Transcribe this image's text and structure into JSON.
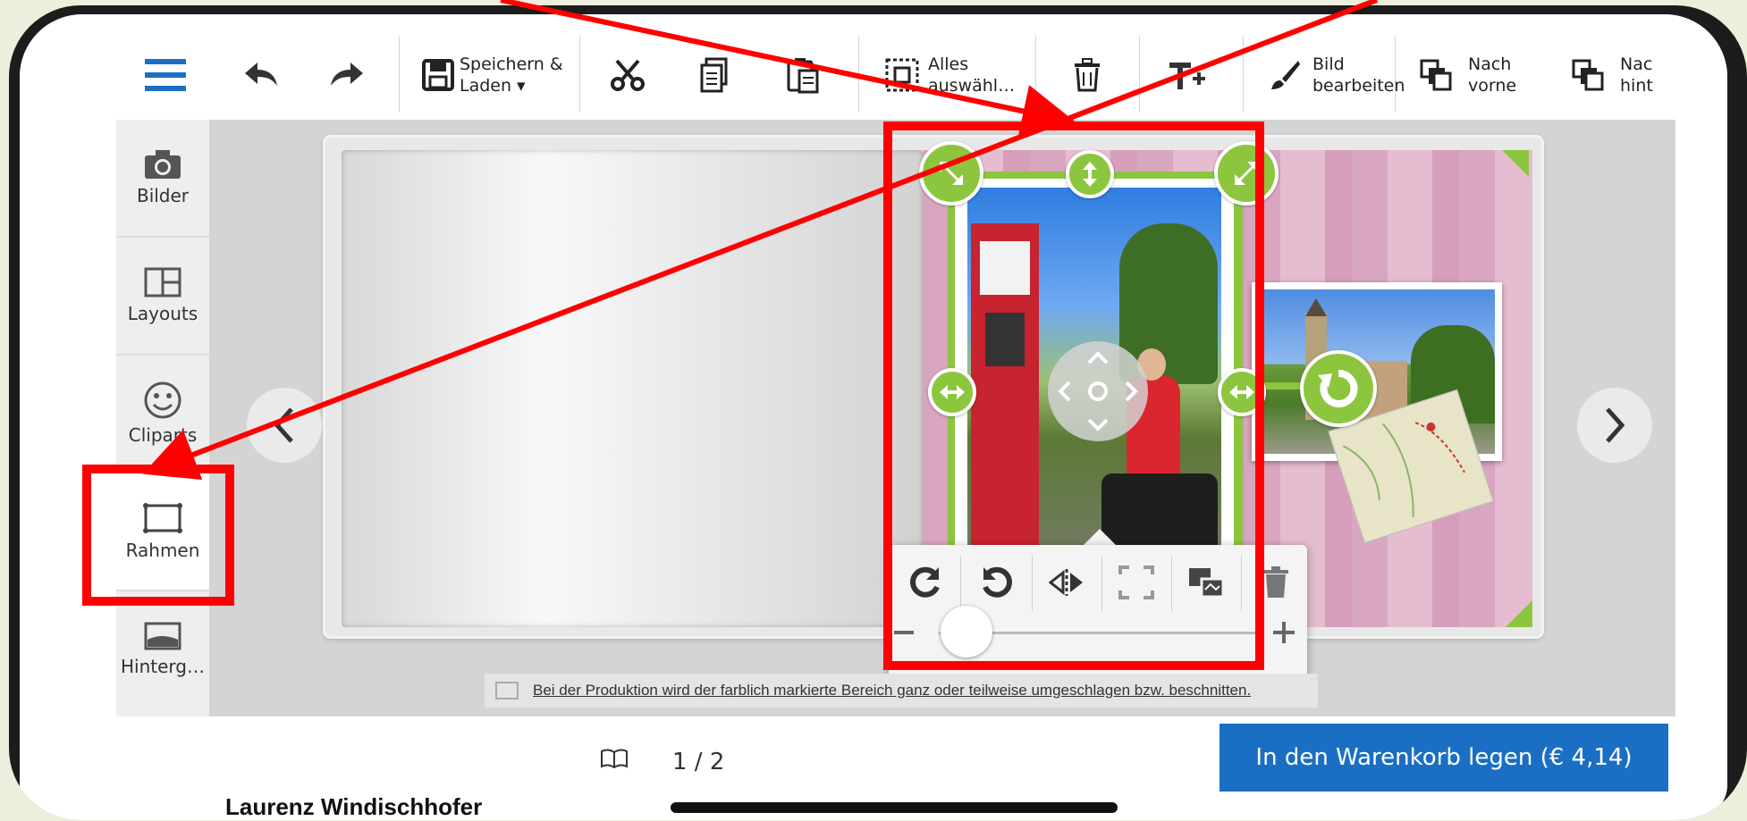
{
  "toolbar": {
    "save_label_1": "Speichern &",
    "save_label_2": "Laden ▾",
    "select_all_1": "Alles",
    "select_all_2": "auswähl…",
    "edit_image_1": "Bild",
    "edit_image_2": "bearbeiten",
    "forward_1": "Nach",
    "forward_2": "vorne",
    "backward_1": "Nac",
    "backward_2": "hint"
  },
  "sidebar": {
    "items": [
      {
        "label": "Bilder"
      },
      {
        "label": "Layouts"
      },
      {
        "label": "Cliparts"
      },
      {
        "label": "Rahmen"
      },
      {
        "label": "Hinterg…"
      }
    ]
  },
  "notice": {
    "text": "Bei der Produktion wird der farblich markierte Bereich ganz oder teilweise umgeschlagen bzw. beschnitten."
  },
  "footer": {
    "page_indicator": "1 / 2",
    "cart_button": "In den Warenkorb legen (€ 4,14)"
  },
  "caption": {
    "author": "Laurenz Windischhofer"
  },
  "colors": {
    "accent_blue": "#1a6fc4",
    "handle_green": "#8cc63f",
    "annotation_red": "#ff0000",
    "page_pink": "#d9a6c0"
  }
}
